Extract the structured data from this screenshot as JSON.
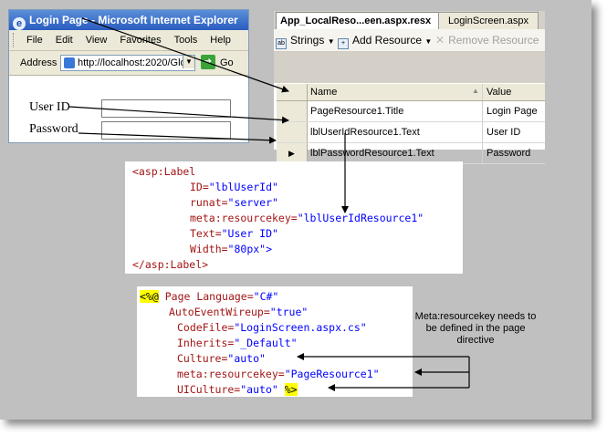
{
  "browser": {
    "title": "Login Page - Microsoft Internet Explorer",
    "menu": [
      "File",
      "Edit",
      "View",
      "Favorites",
      "Tools",
      "Help"
    ],
    "address_label": "Address",
    "url": "http://localhost:2020/Glo",
    "go_label": "Go",
    "form": {
      "user_id_label": "User ID",
      "password_label": "Password"
    }
  },
  "editor": {
    "tabs": [
      {
        "label": "App_LocalReso...een.aspx.resx",
        "active": true
      },
      {
        "label": "LoginScreen.aspx",
        "active": false
      }
    ],
    "toolbar": {
      "strings_label": "Strings",
      "add_resource_label": "Add Resource",
      "remove_resource_label": "Remove Resource"
    },
    "grid": {
      "headers": {
        "name": "Name",
        "value": "Value"
      },
      "rows": [
        {
          "name": "PageResource1.Title",
          "value": "Login Page"
        },
        {
          "name": "lblUserIdResource1.Text",
          "value": "User ID"
        },
        {
          "name": "lblPasswordResource1.Text",
          "value": "Password"
        }
      ]
    }
  },
  "label_code": {
    "l1": "<asp:Label",
    "l2_attr": "ID=",
    "l2_val": "\"lblUserId\"",
    "l3_attr": "runat=",
    "l3_val": "\"server\"",
    "l4_attr": "meta:resourcekey=",
    "l4_val": "\"lblUserIdResource1\"",
    "l5_attr": "Text=",
    "l5_val": "\"User ID\"",
    "l6_attr": "Width=",
    "l6_val": "\"80px\">",
    "l7": "</asp:Label>"
  },
  "page_code": {
    "open": "<%@",
    "l1_attr": "Page Language=",
    "l1_val": "\"C#\"",
    "l2_attr": "AutoEventWireup=",
    "l2_val": "\"true\"",
    "l3_attr": "CodeFile=",
    "l3_val": "\"LoginScreen.aspx.cs\"",
    "l4_attr": "Inherits=",
    "l4_val": "\"_Default\"",
    "l5_attr": "Culture=",
    "l5_val": "\"auto\"",
    "l6_attr": "meta:resourcekey=",
    "l6_val": "\"PageResource1\"",
    "l7_attr": "UICulture=",
    "l7_val": "\"auto\"",
    "close": "%>"
  },
  "note": "Meta:resourcekey needs to be defined in the page directive"
}
